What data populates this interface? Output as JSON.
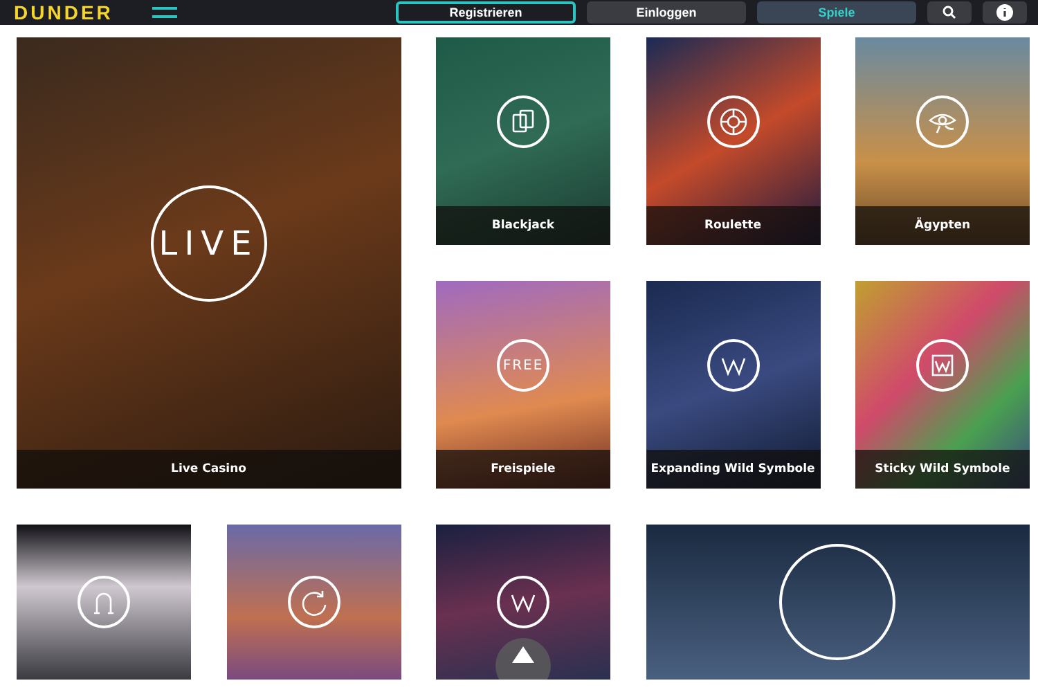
{
  "header": {
    "logo": "DUNDER",
    "nav": [
      {
        "label": "Registrieren",
        "kind": "outline",
        "selected": false
      },
      {
        "label": "Einloggen",
        "kind": "plain",
        "selected": false
      },
      {
        "label": "Spiele",
        "kind": "plain",
        "selected": true
      }
    ]
  },
  "tiles": [
    {
      "kind": "large",
      "icon_text": "LIVE",
      "label": "Live Casino"
    },
    {
      "kind": "small",
      "label": "Blackjack"
    },
    {
      "kind": "small",
      "label": "Roulette"
    },
    {
      "kind": "small",
      "label": "Ägypten"
    },
    {
      "kind": "small",
      "icon_text": "FREE",
      "label": "Freispiele"
    },
    {
      "kind": "small",
      "label": "Expanding Wild Symbole"
    },
    {
      "kind": "small",
      "label": "Sticky Wild Symbole"
    },
    {
      "kind": "small"
    },
    {
      "kind": "small"
    },
    {
      "kind": "small"
    },
    {
      "kind": "wide"
    }
  ]
}
